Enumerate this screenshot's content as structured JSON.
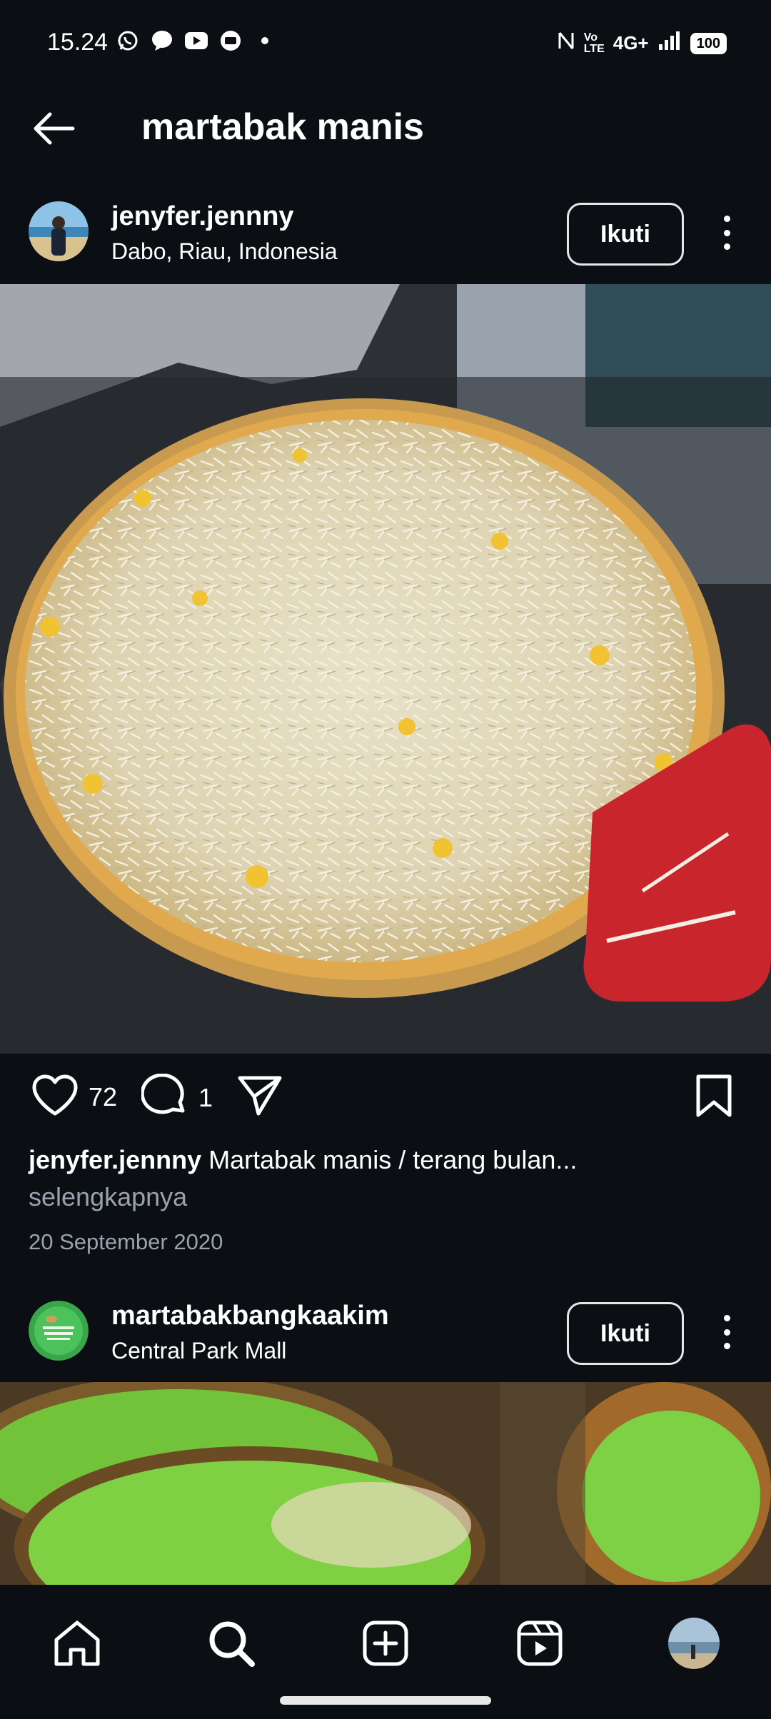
{
  "status_bar": {
    "time": "15.24",
    "network": "4G+",
    "battery": "100"
  },
  "header": {
    "title": "martabak manis"
  },
  "post1": {
    "username": "jenyfer.jennny",
    "location": "Dabo, Riau, Indonesia",
    "follow_label": "Ikuti",
    "likes": "72",
    "comments": "1",
    "caption_user": "jenyfer.jennny",
    "caption_text": "Martabak manis / terang bulan...",
    "more_label": "selengkapnya",
    "date": "20 September 2020"
  },
  "post2": {
    "username": "martabakbangkaakim",
    "location": "Central Park Mall",
    "follow_label": "Ikuti"
  },
  "nav": {
    "items": [
      "home-icon",
      "search-icon",
      "create-icon",
      "reels-icon",
      "profile-icon"
    ]
  },
  "colors": {
    "background": "#0b0f14",
    "secondary_text": "#9aa3ad",
    "bubble_text": "#ffffff"
  }
}
